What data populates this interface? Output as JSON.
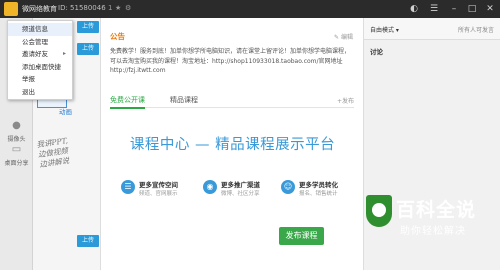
{
  "titlebar": {
    "app_name": "微网络教育",
    "id_text": "ID: 51580046",
    "count": "1",
    "star": "★",
    "gear": "⚙"
  },
  "menu": {
    "items": [
      {
        "label": "频道信息"
      },
      {
        "label": "公会管理"
      },
      {
        "label": "邀请好友",
        "arrow": "▸"
      },
      {
        "label": "添加桌面快捷"
      },
      {
        "label": "举报"
      },
      {
        "label": "退出"
      }
    ]
  },
  "col2": {
    "btn1": "上传",
    "btn2": "上传",
    "btn3": "上传",
    "link": "动画",
    "handwriting": [
      "我讲PPT,",
      "边做视频",
      "边讲解说"
    ]
  },
  "sidebar": {
    "items": [
      {
        "label": "摄像头"
      },
      {
        "label": "桌面分享"
      }
    ]
  },
  "main": {
    "notice_title": "公告",
    "edit": "编辑",
    "notice_text": "免费教学！服务到底！加单你想学所电脑知识，请在课堂上留评论！加单你想学电脑课程，可以去淘宝购买我的课程！淘宝地址：http://shop110933018.taobao.com/官网地址http://fzj.itwtt.com",
    "tabs": [
      "免费公开课",
      "精品课程"
    ],
    "publish_link": "+发布",
    "hero": "课程中心 — 精品课程展示平台",
    "features": [
      {
        "title": "更多宣传空间",
        "sub": "频道、官网展示"
      },
      {
        "title": "更多推广渠道",
        "sub": "微博、社区分享"
      },
      {
        "title": "更多学员转化",
        "sub": "报名、销售统计"
      }
    ],
    "publish_button": "发布课程"
  },
  "rightpanel": {
    "mode": "自由模式",
    "only": "所有人可发言",
    "discuss": "讨论"
  },
  "watermark": {
    "big": "百科全说",
    "sub": "助你轻松解决"
  },
  "colors": {
    "accent_green": "#3aa84a",
    "accent_blue": "#3a9ad9",
    "notice_orange": "#f07800"
  }
}
